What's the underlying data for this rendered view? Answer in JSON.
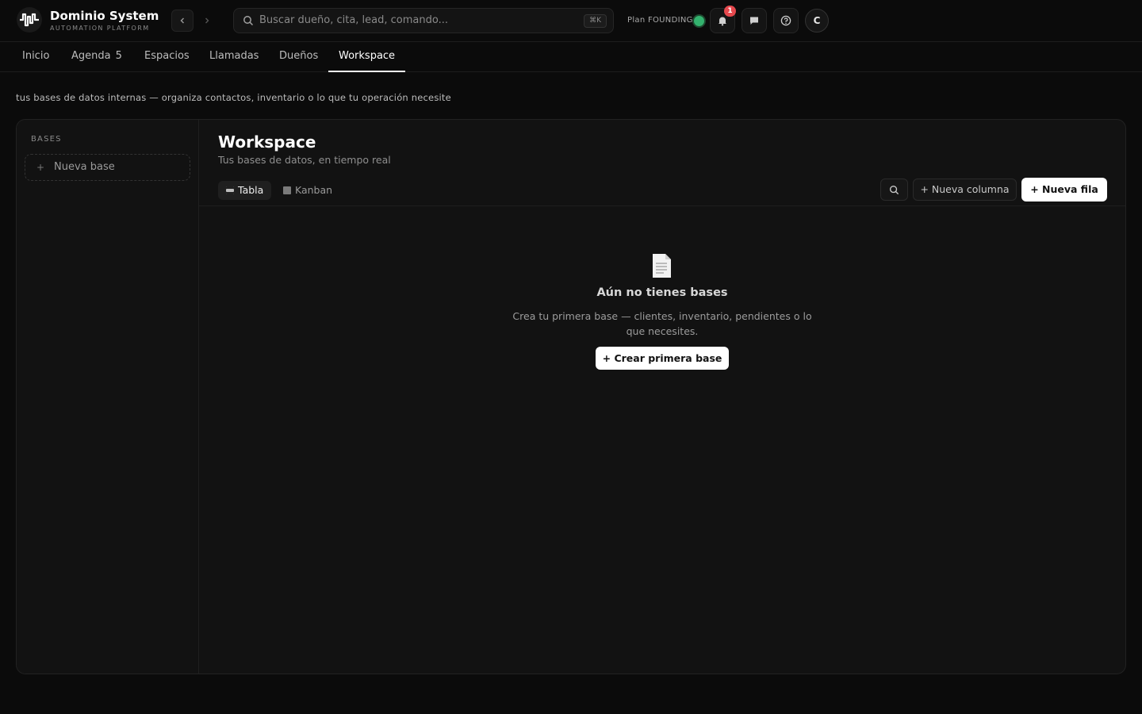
{
  "brand": {
    "title": "Dominio System",
    "subtitle": "AUTOMATION PLATFORM",
    "logo_icon": "pulse-logo-icon"
  },
  "search": {
    "placeholder": "Buscar dueño, cita, lead, comando...",
    "shortcut": "⌘K"
  },
  "plan": {
    "label": "Plan FOUNDING",
    "status_color": "#33b26e"
  },
  "notifications": {
    "count": "1"
  },
  "user": {
    "initial": "C"
  },
  "tabs": [
    {
      "label": "Inicio"
    },
    {
      "label": "Agenda",
      "count": "5"
    },
    {
      "label": "Espacios"
    },
    {
      "label": "Llamadas"
    },
    {
      "label": "Dueños"
    },
    {
      "label": "Workspace",
      "active": true
    }
  ],
  "description": "tus bases de datos internas — organiza contactos, inventario o lo que tu operación necesite",
  "sidebar": {
    "title": "BASES",
    "new_base": "Nueva base",
    "new_base_icon": "+"
  },
  "main": {
    "title": "Workspace",
    "subtitle": "Tus bases de datos, en tiempo real",
    "views": [
      "Tabla",
      "Kanban"
    ],
    "active_view": "Tabla",
    "new_column": "+ Nueva columna",
    "new_row": "+ Nueva fila"
  },
  "empty_state": {
    "icon": "document-icon",
    "title": "Aún no tienes bases",
    "text": "Crea tu primera base — clientes, inventario, pendientes o lo que necesites.",
    "cta": "+ Crear primera base"
  },
  "colors": {
    "background": "#0b0b0b",
    "panel": "#121212",
    "accent": "#ffffff",
    "badge": "#e5484d"
  }
}
